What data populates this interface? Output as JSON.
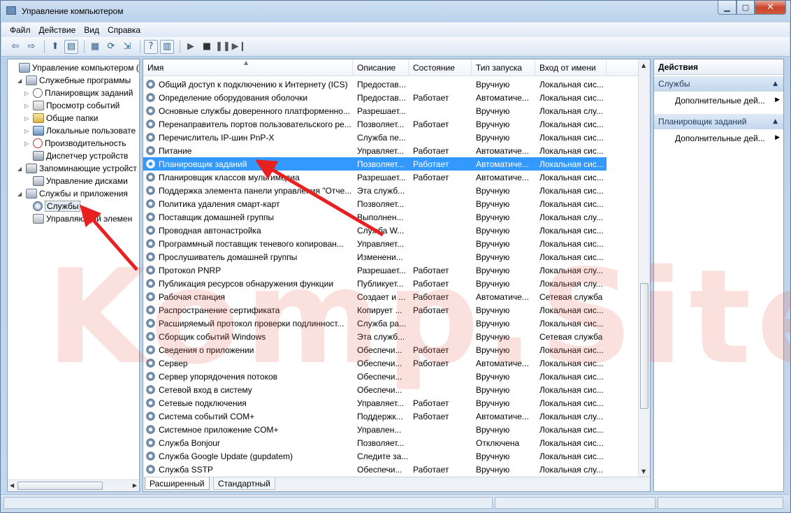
{
  "window": {
    "title": "Управление компьютером"
  },
  "menu": [
    "Файл",
    "Действие",
    "Вид",
    "Справка"
  ],
  "tree": [
    {
      "label": "Управление компьютером (л",
      "indent": 0,
      "icon": "computer-icon",
      "exp": ""
    },
    {
      "label": "Служебные программы",
      "indent": 1,
      "icon": "tools-icon",
      "exp": "◢"
    },
    {
      "label": "Планировщик заданий",
      "indent": 2,
      "icon": "clock-icon",
      "exp": "▷"
    },
    {
      "label": "Просмотр событий",
      "indent": 2,
      "icon": "event-log-icon",
      "exp": "▷"
    },
    {
      "label": "Общие папки",
      "indent": 2,
      "icon": "shared-folder-icon",
      "exp": "▷"
    },
    {
      "label": "Локальные пользовате",
      "indent": 2,
      "icon": "users-icon",
      "exp": "▷"
    },
    {
      "label": "Производительность",
      "indent": 2,
      "icon": "performance-icon",
      "exp": "▷"
    },
    {
      "label": "Диспетчер устройств",
      "indent": 2,
      "icon": "device-manager-icon",
      "exp": ""
    },
    {
      "label": "Запоминающие устройст",
      "indent": 1,
      "icon": "storage-icon",
      "exp": "◢"
    },
    {
      "label": "Управление дисками",
      "indent": 2,
      "icon": "disk-icon",
      "exp": ""
    },
    {
      "label": "Службы и приложения",
      "indent": 1,
      "icon": "services-apps-icon",
      "exp": "◢"
    },
    {
      "label": "Службы",
      "indent": 2,
      "icon": "services-icon",
      "exp": "",
      "selected": true
    },
    {
      "label": "Управляющий элемен",
      "indent": 2,
      "icon": "wmi-icon",
      "exp": ""
    }
  ],
  "columns": [
    "Имя",
    "Описание",
    "Состояние",
    "Тип запуска",
    "Вход от имени"
  ],
  "services": [
    [
      "Общий доступ к подключению к Интернету (ICS)",
      "Предостав...",
      "",
      "Вручную",
      "Локальная сис..."
    ],
    [
      "Определение оборудования оболочки",
      "Предостав...",
      "Работает",
      "Автоматиче...",
      "Локальная сис..."
    ],
    [
      "Основные службы доверенного платформенно...",
      "Разрешает...",
      "",
      "Вручную",
      "Локальная слу..."
    ],
    [
      "Перенаправитель портов пользовательского ре...",
      "Позволяет...",
      "Работает",
      "Вручную",
      "Локальная сис..."
    ],
    [
      "Перечислитель IP-шин PnP-X",
      "Служба пе...",
      "",
      "Вручную",
      "Локальная сис..."
    ],
    [
      "Питание",
      "Управляет...",
      "Работает",
      "Автоматиче...",
      "Локальная сис..."
    ],
    [
      "Планировщик заданий",
      "Позволяет...",
      "Работает",
      "Автоматиче...",
      "Локальная сис..."
    ],
    [
      "Планировщик классов мультимедиа",
      "Разрешает...",
      "Работает",
      "Автоматиче...",
      "Локальная сис..."
    ],
    [
      "Поддержка элемента панели управления \"Отче...",
      "Эта служб...",
      "",
      "Вручную",
      "Локальная сис..."
    ],
    [
      "Политика удаления смарт-карт",
      "Позволяет...",
      "",
      "Вручную",
      "Локальная сис..."
    ],
    [
      "Поставщик домашней группы",
      "Выполнен...",
      "",
      "Вручную",
      "Локальная слу..."
    ],
    [
      "Проводная автонастройка",
      "Служба W...",
      "",
      "Вручную",
      "Локальная сис..."
    ],
    [
      "Программный поставщик теневого копирован...",
      "Управляет...",
      "",
      "Вручную",
      "Локальная сис..."
    ],
    [
      "Прослушиватель домашней группы",
      "Изменени...",
      "",
      "Вручную",
      "Локальная сис..."
    ],
    [
      "Протокол PNRP",
      "Разрешает...",
      "Работает",
      "Вручную",
      "Локальная слу..."
    ],
    [
      "Публикация ресурсов обнаружения функции",
      "Публикует...",
      "Работает",
      "Вручную",
      "Локальная слу..."
    ],
    [
      "Рабочая станция",
      "Создает и ...",
      "Работает",
      "Автоматиче...",
      "Сетевая служба"
    ],
    [
      "Распространение сертификата",
      "Копирует ...",
      "Работает",
      "Вручную",
      "Локальная сис..."
    ],
    [
      "Расширяемый протокол проверки подлинност...",
      "Служба ра...",
      "",
      "Вручную",
      "Локальная сис..."
    ],
    [
      "Сборщик событий Windows",
      "Эта служб...",
      "",
      "Вручную",
      "Сетевая служба"
    ],
    [
      "Сведения о приложении",
      "Обеспечи...",
      "Работает",
      "Вручную",
      "Локальная сис..."
    ],
    [
      "Сервер",
      "Обеспечи...",
      "Работает",
      "Автоматиче...",
      "Локальная сис..."
    ],
    [
      "Сервер упорядочения потоков",
      "Обеспечи...",
      "",
      "Вручную",
      "Локальная сис..."
    ],
    [
      "Сетевой вход в систему",
      "Обеспечи...",
      "",
      "Вручную",
      "Локальная сис..."
    ],
    [
      "Сетевые подключения",
      "Управляет...",
      "Работает",
      "Вручную",
      "Локальная сис..."
    ],
    [
      "Система событий COM+",
      "Поддержк...",
      "Работает",
      "Автоматиче...",
      "Локальная слу..."
    ],
    [
      "Системное приложение COM+",
      "Управлен...",
      "",
      "Вручную",
      "Локальная сис..."
    ],
    [
      "Служба Bonjour",
      "Позволяет...",
      "",
      "Отключена",
      "Локальная сис..."
    ],
    [
      "Служба Google Update (gupdatem)",
      "Следите за...",
      "",
      "Вручную",
      "Локальная сис..."
    ],
    [
      "Служба SSTP",
      "Обеспечи...",
      "Работает",
      "Вручную",
      "Локальная слу..."
    ]
  ],
  "selected_service_index": 6,
  "tabs": [
    "Расширенный",
    "Стандартный"
  ],
  "actions": {
    "title": "Действия",
    "sections": [
      {
        "label": "Службы",
        "item": "Дополнительные дей..."
      },
      {
        "label": "Планировщик заданий",
        "item": "Дополнительные дей..."
      }
    ]
  },
  "watermark": "Komp.Site",
  "colors": {
    "selection": "#3399ff",
    "arrow": "#e8201f",
    "watermark": "#eb5a46"
  }
}
